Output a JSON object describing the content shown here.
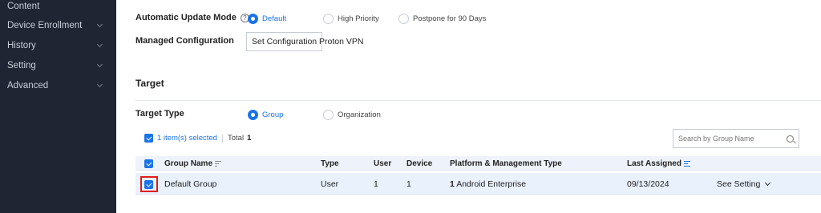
{
  "sidebar": {
    "items": [
      {
        "label": "Content",
        "has_chevron": false
      },
      {
        "label": "Device Enrollment",
        "has_chevron": true
      },
      {
        "label": "History",
        "has_chevron": true
      },
      {
        "label": "Setting",
        "has_chevron": true
      },
      {
        "label": "Advanced",
        "has_chevron": true
      }
    ]
  },
  "update_mode": {
    "label": "Automatic Update Mode",
    "help_icon": "?",
    "options": [
      "Default",
      "High Priority",
      "Postpone for 90 Days"
    ],
    "selected": "Default"
  },
  "managed_config": {
    "label": "Managed Configuration",
    "button_label": "Set Configuration",
    "value": "Proton VPN"
  },
  "target": {
    "section_title": "Target",
    "type_label": "Target Type",
    "options": [
      "Group",
      "Organization"
    ],
    "selected": "Group"
  },
  "selection": {
    "selected_text": "1 item(s) selected",
    "total_label": "Total",
    "total_count": "1"
  },
  "search": {
    "placeholder": "Search by Group Name"
  },
  "table": {
    "columns": [
      "Group Name",
      "Type",
      "User",
      "Device",
      "Platform & Management Type",
      "Last Assigned"
    ],
    "rows": [
      {
        "group_name": "Default Group",
        "type": "User",
        "user": "1",
        "device": "1",
        "platform_count": "1",
        "platform_name": "Android Enterprise",
        "last_assigned": "09/13/2024",
        "action": "See Setting"
      }
    ]
  },
  "colors": {
    "accent": "#1a73e8",
    "sidebar_bg": "#1f2533",
    "highlight_border": "#e01b1b"
  }
}
